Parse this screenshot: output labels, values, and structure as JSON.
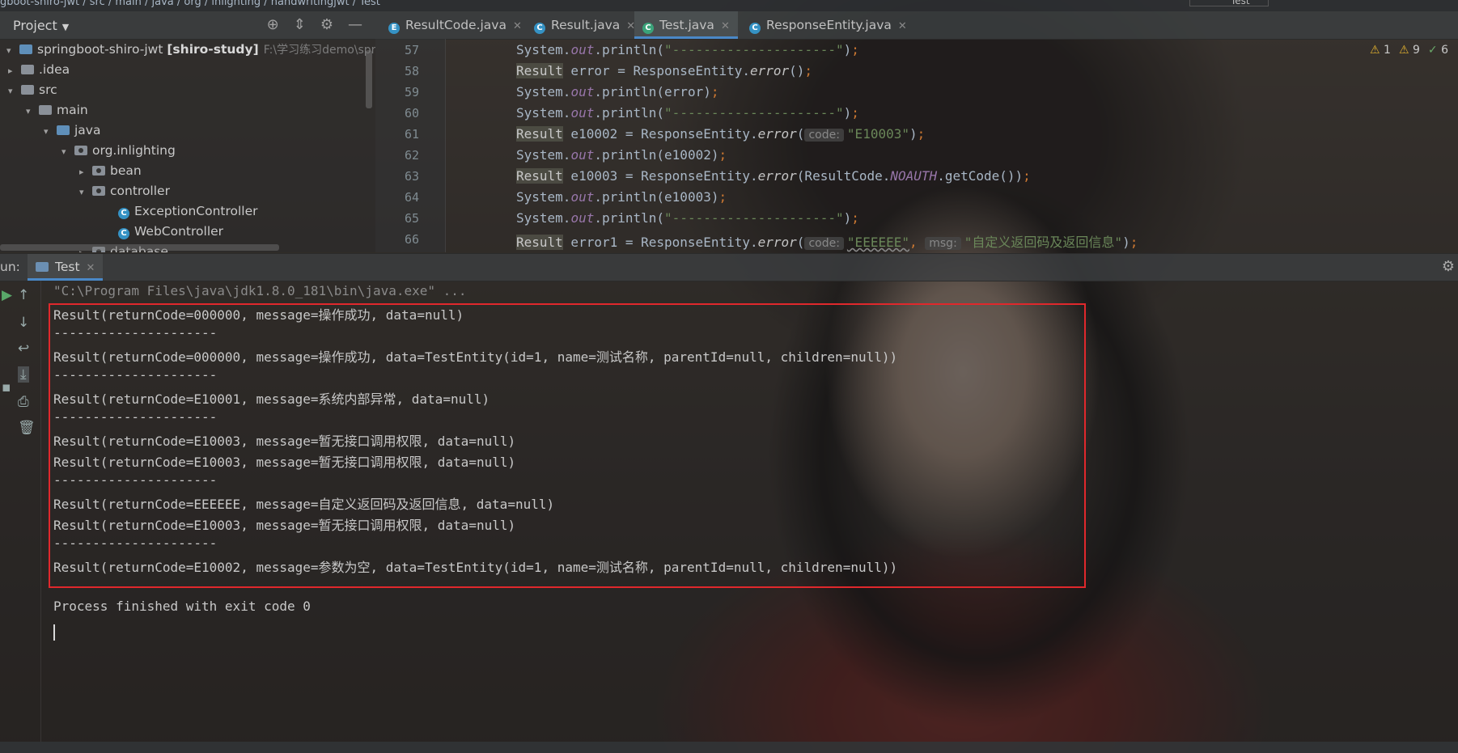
{
  "topbar": {
    "breadcrumb": "gboot-shiro-jwt  /  src  /  main  /  java  /  org  /  inlighting  /  handwritingjwt  /  Test",
    "run_config": "Test"
  },
  "project": {
    "title": "Project",
    "tree": [
      {
        "label": "springboot-shiro-jwt",
        "bold_suffix": "[shiro-study]",
        "path": "F:\\学习练习demo\\spring",
        "depth": 0,
        "expanded": true
      },
      {
        "label": ".idea",
        "depth": 1,
        "expanded": false
      },
      {
        "label": "src",
        "depth": 1,
        "expanded": true
      },
      {
        "label": "main",
        "depth": 2,
        "expanded": true
      },
      {
        "label": "java",
        "depth": 3,
        "expanded": true
      },
      {
        "label": "org.inlighting",
        "depth": 4,
        "expanded": true
      },
      {
        "label": "bean",
        "depth": 5,
        "expanded": false
      },
      {
        "label": "controller",
        "depth": 5,
        "expanded": true
      },
      {
        "label": "ExceptionController",
        "depth": 6,
        "class": true
      },
      {
        "label": "WebController",
        "depth": 6,
        "class": true
      },
      {
        "label": "database",
        "depth": 5,
        "expanded": false
      }
    ]
  },
  "editor": {
    "tabs": [
      {
        "label": "ResultCode.java",
        "icon": "E",
        "color": "#3592c4",
        "active": false
      },
      {
        "label": "Result.java",
        "icon": "C",
        "color": "#3592c4",
        "active": false
      },
      {
        "label": "Test.java",
        "icon": "C",
        "color": "#3aa37a",
        "active": true
      },
      {
        "label": "ResponseEntity.java",
        "icon": "C",
        "color": "#3592c4",
        "active": false
      }
    ],
    "line_numbers": [
      "57",
      "58",
      "59",
      "60",
      "61",
      "62",
      "63",
      "64",
      "65",
      "66"
    ],
    "warnings": {
      "w1": "1",
      "w2": "9",
      "ok": "6"
    },
    "code": {
      "l57": "\"---------------------\"",
      "l58_type": "Result",
      "l58_var": " error = ResponseEntity.",
      "l58_m": "error",
      "l58_end": "()",
      "l59_arg": "(error)",
      "l60": "\"---------------------\"",
      "l61_type": "Result",
      "l61_var": " e10002 = ResponseEntity.",
      "l61_m": "error",
      "l61_hint": "code:",
      "l61_s": "\"E10003\"",
      "l62_arg": "(e10002)",
      "l63_type": "Result",
      "l63_var": " e10003 = ResponseEntity.",
      "l63_m": "error",
      "l63_arg1": "(ResultCode.",
      "l63_cst": "NOAUTH",
      "l63_arg2": ".getCode())",
      "l64_arg": "(e10003)",
      "l65": "\"---------------------\"",
      "l66_type": "Result",
      "l66_var": " error1 = ResponseEntity.",
      "l66_m": "error",
      "l66_hint1": "code:",
      "l66_s1": "\"EEEEEE\"",
      "l66_hint2": "msg:",
      "l66_s2": "\"自定义返回码及返回信息\"",
      "sys": "System.",
      "out": "out",
      "println": ".println"
    }
  },
  "run": {
    "label": "un:",
    "tab": "Test",
    "command": "\"C:\\Program Files\\java\\jdk1.8.0_181\\bin\\java.exe\" ...",
    "output": [
      "Result(returnCode=000000, message=操作成功, data=null)",
      "---------------------",
      "Result(returnCode=000000, message=操作成功, data=TestEntity(id=1, name=测试名称, parentId=null, children=null))",
      "---------------------",
      "Result(returnCode=E10001, message=系统内部异常, data=null)",
      "---------------------",
      "Result(returnCode=E10003, message=暂无接口调用权限, data=null)",
      "Result(returnCode=E10003, message=暂无接口调用权限, data=null)",
      "---------------------",
      "Result(returnCode=EEEEEE, message=自定义返回码及返回信息, data=null)",
      "Result(returnCode=E10003, message=暂无接口调用权限, data=null)",
      "---------------------",
      "Result(returnCode=E10002, message=参数为空, data=TestEntity(id=1, name=测试名称, parentId=null, children=null))"
    ],
    "exit": "Process finished with exit code 0"
  }
}
